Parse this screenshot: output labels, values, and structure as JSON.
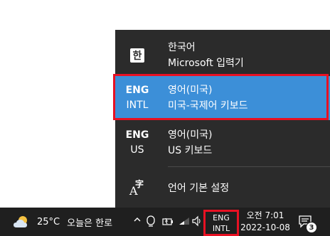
{
  "flyout": {
    "items": [
      {
        "icon": "hangul-icon",
        "glyph": "한",
        "name": "한국어",
        "layout": "Microsoft 입력기",
        "selected": false
      },
      {
        "code_top": "ENG",
        "code_bottom": "INTL",
        "name": "영어(미국)",
        "layout": "미국-국제어 키보드",
        "selected": true
      },
      {
        "code_top": "ENG",
        "code_bottom": "US",
        "name": "영어(미국)",
        "layout": "US 키보드",
        "selected": false
      }
    ],
    "settings": {
      "icon": "language-settings-icon",
      "glyph_a": "A",
      "glyph_ko": "字",
      "label": "언어 기본 설정"
    }
  },
  "taskbar": {
    "weather": {
      "temp": "25°C",
      "text": "오늘은 한로"
    },
    "ime": {
      "top": "ENG",
      "bottom": "INTL"
    },
    "clock": {
      "time": "오전 7:01",
      "date": "2022-10-08"
    },
    "notifications": {
      "count": "3"
    }
  },
  "colors": {
    "flyout_bg": "#2b2b2b",
    "selected_bg": "#3c8fd8",
    "highlight_frame": "#e81123",
    "taskbar_bg": "#1f1f1f"
  }
}
